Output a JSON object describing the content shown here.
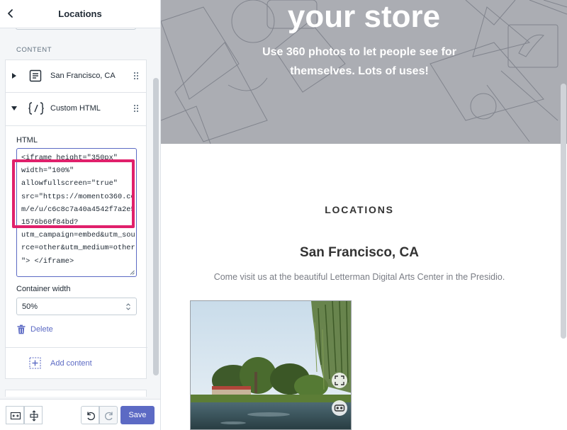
{
  "sidebar": {
    "title": "Locations",
    "section_label": "CONTENT",
    "items": [
      {
        "label": "San Francisco, CA",
        "icon": "text-block-icon"
      },
      {
        "label": "Custom HTML",
        "icon": "code-icon"
      }
    ],
    "html_field": {
      "label": "HTML",
      "value": "<iframe height=\"350px\"\nwidth=\"100%\"\nallowfullscreen=\"true\"\nsrc=\"https://momento360.co\nm/e/u/c6c8c7a40a4542f7a2e5\n1576b60f84bd?\nutm_campaign=embed&utm_sou\nrce=other&utm_medium=other\n\"> </iframe>"
    },
    "container_width": {
      "label": "Container width",
      "value": "50%"
    },
    "delete_label": "Delete",
    "add_content_label": "Add content",
    "save_label": "Save",
    "highlight_color": "#e0206b",
    "accent_color": "#5c6ac4"
  },
  "preview": {
    "hero_title": "your store",
    "hero_subtitle": "Use 360 photos to let people see for themselves. Lots of uses!",
    "section_heading": "LOCATIONS",
    "location_title": "San Francisco, CA",
    "location_description": "Come visit us at the beautiful Letterman Digital Arts Center in the Presidio."
  }
}
